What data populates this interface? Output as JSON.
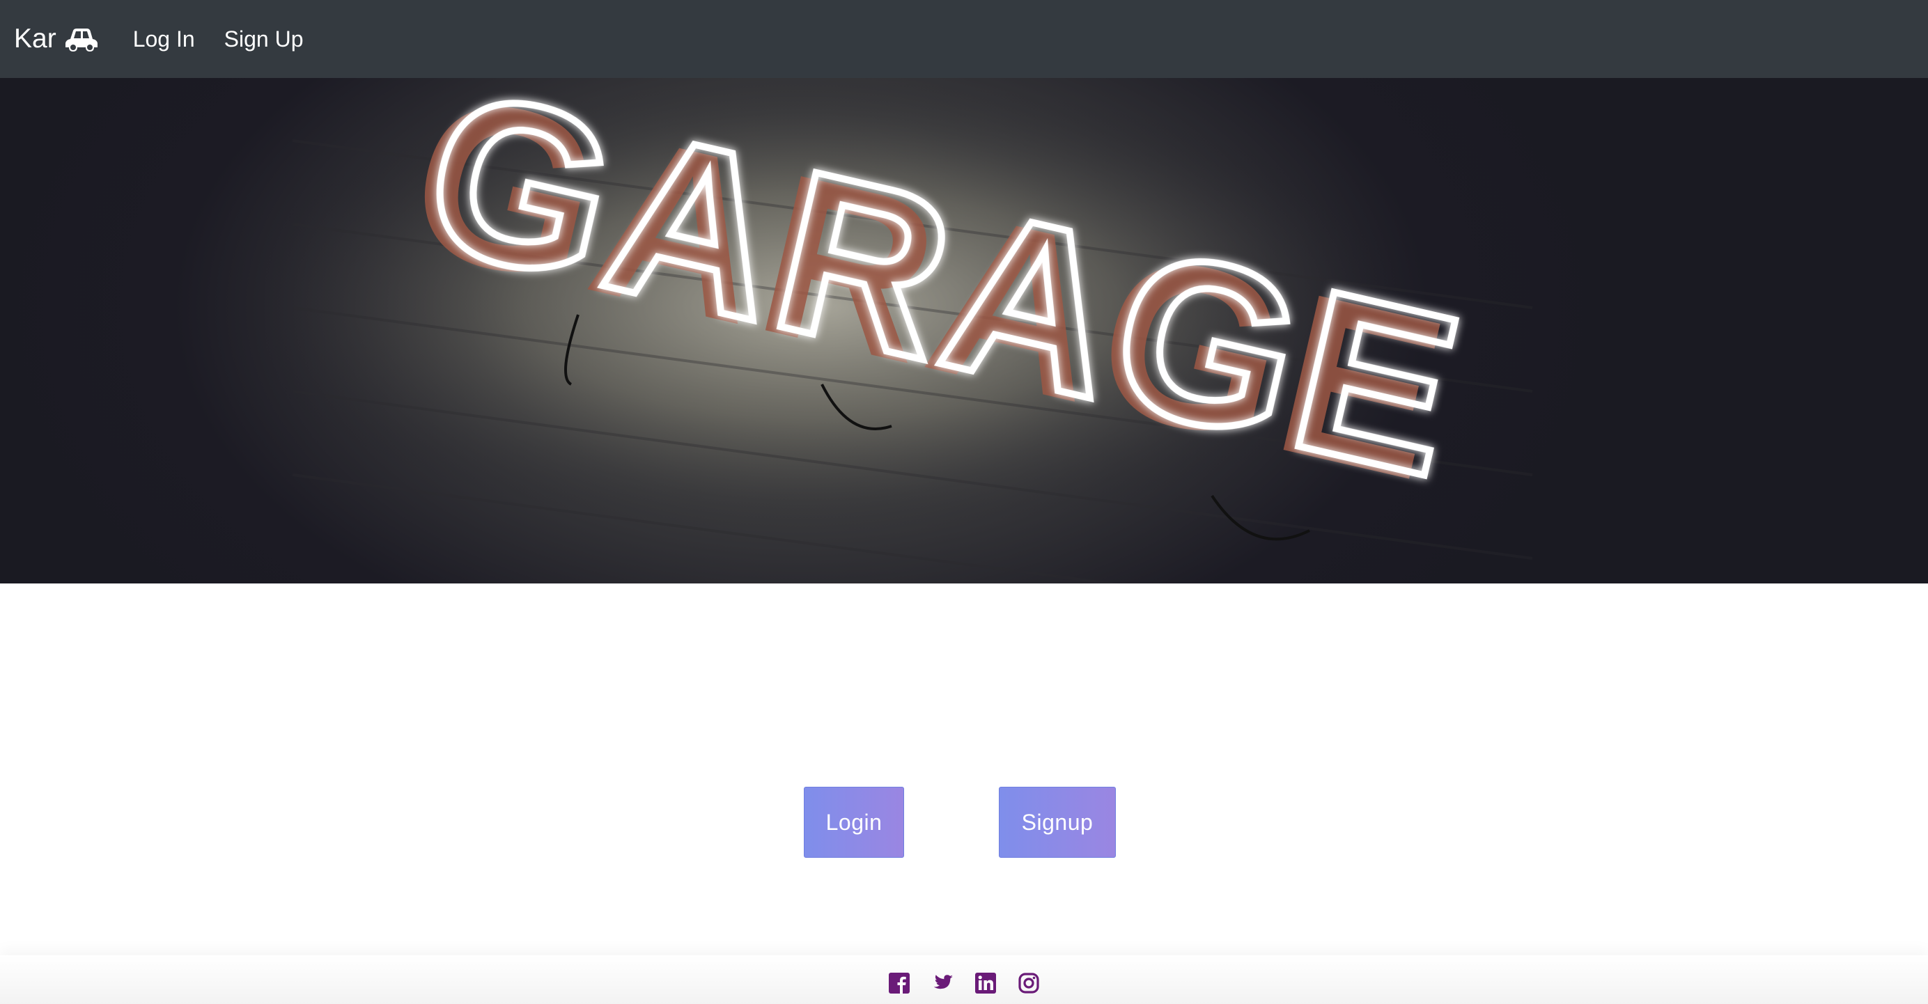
{
  "navbar": {
    "brand": "Kar",
    "brand_icon": "car-icon",
    "links": [
      {
        "label": "Log In"
      },
      {
        "label": "Sign Up"
      }
    ]
  },
  "hero": {
    "sign_text": "GARAGE",
    "image_icon": "neon-garage-sign-image"
  },
  "actions": {
    "login_label": "Login",
    "signup_label": "Signup"
  },
  "footer": {
    "social": [
      {
        "icon": "facebook-icon"
      },
      {
        "icon": "twitter-icon"
      },
      {
        "icon": "linkedin-icon"
      },
      {
        "icon": "instagram-icon"
      }
    ],
    "icon_color": "#6a1b78"
  },
  "colors": {
    "navbar_bg": "#343a40",
    "button_gradient_start": "#7f8eeb",
    "button_gradient_end": "#9a86e2"
  }
}
